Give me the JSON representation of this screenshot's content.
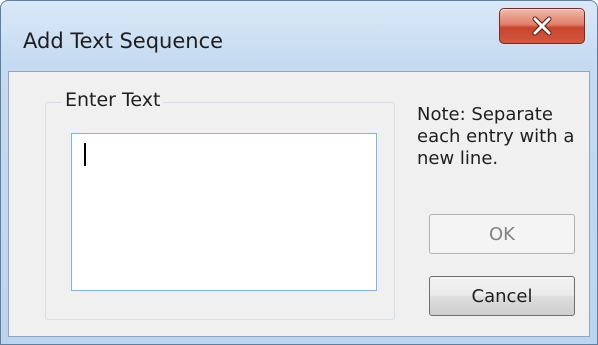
{
  "window": {
    "title": "Add Text Sequence",
    "close_icon": "close-x-icon"
  },
  "group": {
    "label": "Enter Text",
    "input_value": ""
  },
  "note": {
    "text": "Note: Separate each entry with a new line."
  },
  "buttons": {
    "ok_label": "OK",
    "ok_enabled": false,
    "cancel_label": "Cancel"
  },
  "colors": {
    "title_bar": "#c6dbf1",
    "close_button": "#c8452c",
    "client_background": "#f0f0f0",
    "input_border": "#7eb4ea"
  }
}
